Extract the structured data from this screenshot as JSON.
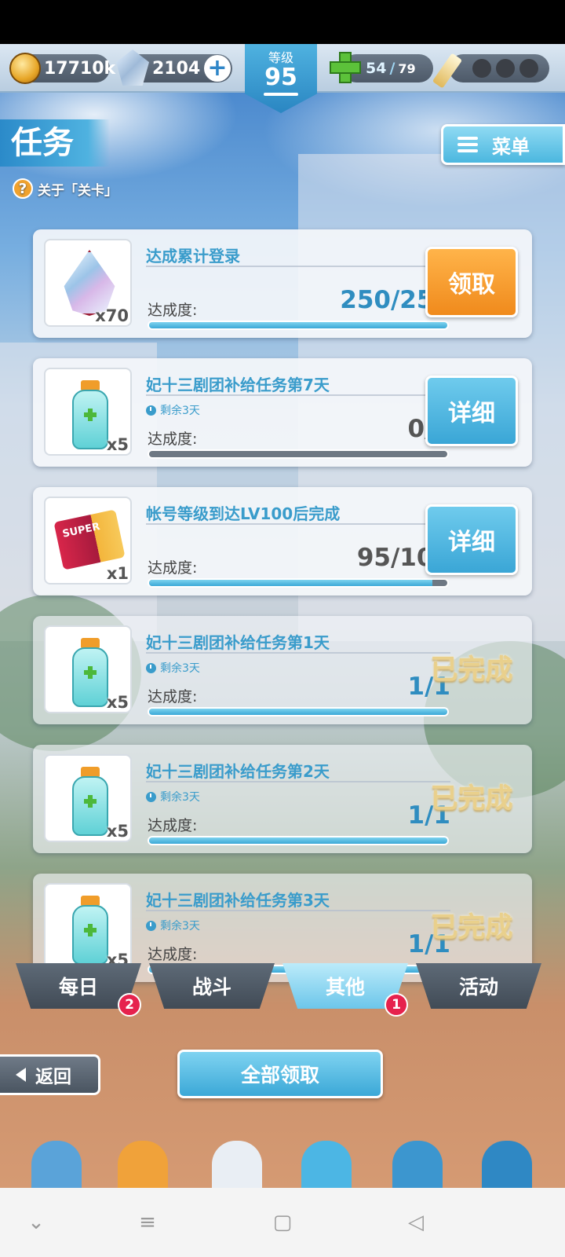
{
  "hud": {
    "gold": "17710k",
    "gems": "2104",
    "level_label": "等级",
    "level": "95",
    "stamina_current": "54",
    "stamina_max": "79"
  },
  "page": {
    "title": "任务",
    "about_link": "关于「关卡」",
    "menu_label": "菜单"
  },
  "missions": [
    {
      "title": "达成累计登录",
      "remaining": "",
      "progress_label": "达成度:",
      "progress": "250/250",
      "progress_fraction": 1.0,
      "qty": "x70",
      "item_icon": "crystal-gem-icon",
      "action": "领取",
      "state": "claim"
    },
    {
      "title": "妃十三剧团补给任务第7天",
      "remaining": "剩余3天",
      "progress_label": "达成度:",
      "progress": "0/1",
      "progress_fraction": 0.0,
      "qty": "x5",
      "item_icon": "potion-bottle-icon",
      "action": "详细",
      "state": "detail"
    },
    {
      "title": "帐号等级到达LV100后完成",
      "remaining": "",
      "progress_label": "达成度:",
      "progress": "95/100",
      "progress_fraction": 0.95,
      "qty": "x1",
      "item_icon": "super-cookie-ticket-icon",
      "action": "详细",
      "state": "detail"
    },
    {
      "title": "妃十三剧团补给任务第1天",
      "remaining": "剩余3天",
      "progress_label": "达成度:",
      "progress": "1/1",
      "progress_fraction": 1.0,
      "qty": "x5",
      "item_icon": "potion-bottle-icon",
      "action": "已完成",
      "state": "done"
    },
    {
      "title": "妃十三剧团补给任务第2天",
      "remaining": "剩余3天",
      "progress_label": "达成度:",
      "progress": "1/1",
      "progress_fraction": 1.0,
      "qty": "x5",
      "item_icon": "potion-bottle-icon",
      "action": "已完成",
      "state": "done"
    },
    {
      "title": "妃十三剧团补给任务第3天",
      "remaining": "剩余3天",
      "progress_label": "达成度:",
      "progress": "1/1",
      "progress_fraction": 1.0,
      "qty": "x5",
      "item_icon": "potion-bottle-icon",
      "action": "已完成",
      "state": "done"
    }
  ],
  "ticket_text": "SUPER",
  "tabs": [
    {
      "label": "每日",
      "badge": "2"
    },
    {
      "label": "战斗",
      "badge": ""
    },
    {
      "label": "其他",
      "badge": "1",
      "active": true
    },
    {
      "label": "活动",
      "badge": ""
    }
  ],
  "footer": {
    "back_label": "返回",
    "claim_all_label": "全部领取"
  },
  "colors": {
    "accent_blue": "#4bb7df",
    "claim_orange": "#f08a1c",
    "badge_red": "#e6224d",
    "done_gold": "#e9d08c"
  }
}
